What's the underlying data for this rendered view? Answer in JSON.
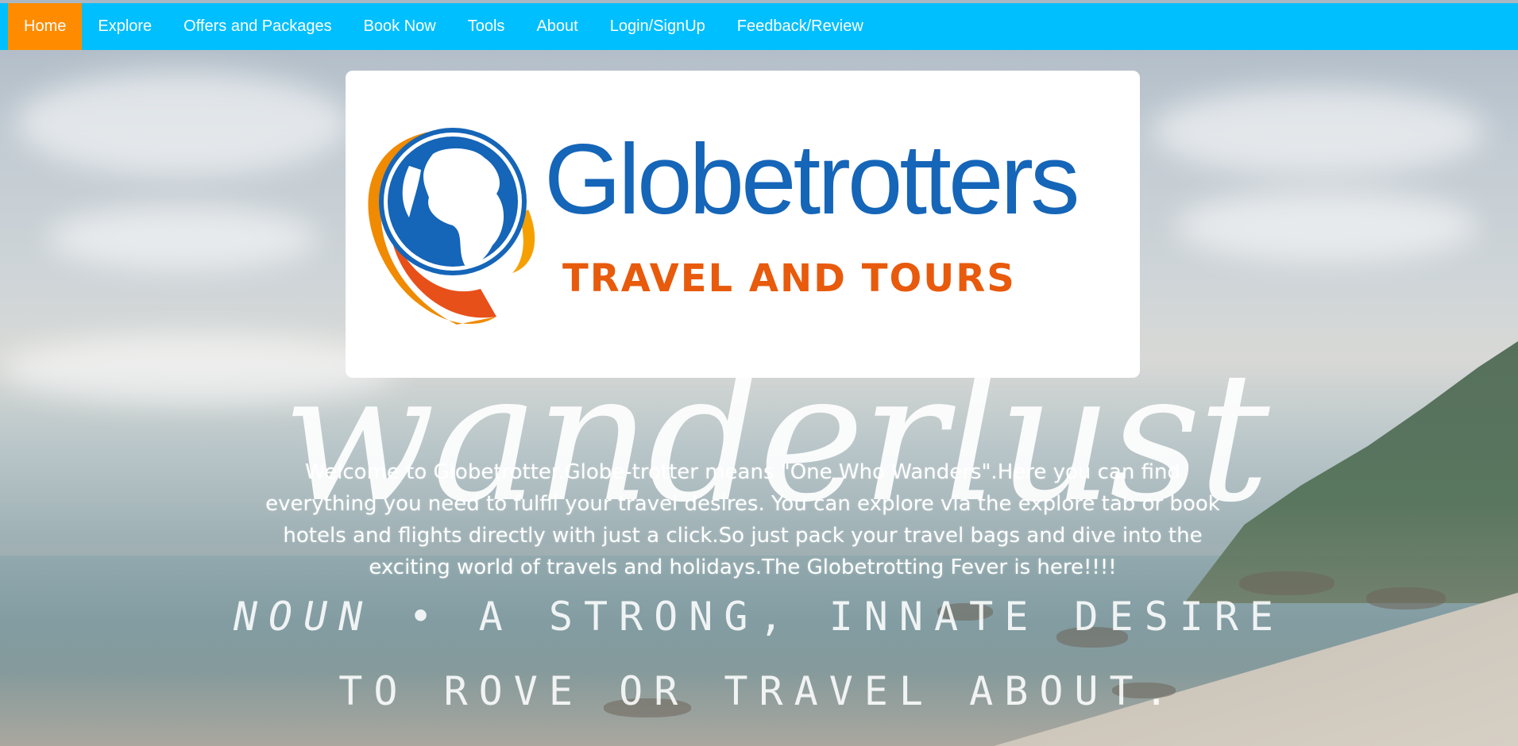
{
  "nav": {
    "items": [
      {
        "label": "Home",
        "active": true
      },
      {
        "label": "Explore"
      },
      {
        "label": "Offers and Packages"
      },
      {
        "label": "Book Now"
      },
      {
        "label": "Tools"
      },
      {
        "label": "About"
      },
      {
        "label": "Login/SignUp"
      },
      {
        "label": "Feedback/Review"
      }
    ]
  },
  "logo": {
    "brand": "Globetrotters",
    "tagline": "TRAVEL AND TOURS"
  },
  "hero": {
    "script_word": "wanderlust",
    "welcome": "Welcome to Globetrotter.Globe-trotter means \"One Who Wanders\".Here you can find everything you need to fulfil your travel desires. You can explore via the explore tab or book hotels and flights directly with just a click.So just pack your travel bags and dive into the exciting world of travels and holidays.The Globetrotting Fever is here!!!!",
    "definition_prefix": "NOUN",
    "definition_line1": "• A STRONG, INNATE DESIRE",
    "definition_line2": "TO ROVE OR TRAVEL ABOUT."
  },
  "colors": {
    "nav_bg": "#00bfff",
    "nav_active": "#ff8c00",
    "brand_blue": "#1565b8",
    "brand_orange": "#e85a0c"
  }
}
